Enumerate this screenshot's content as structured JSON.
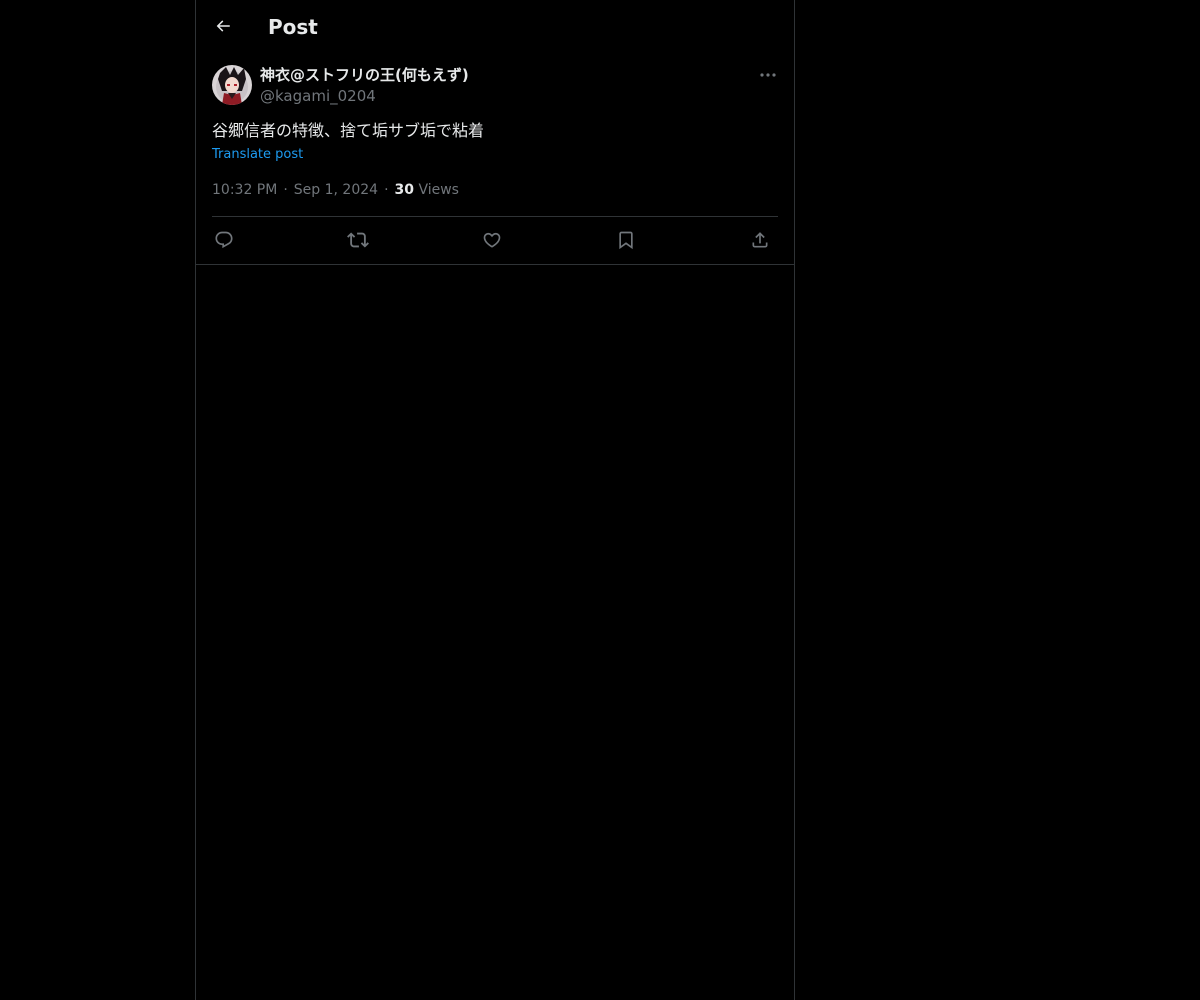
{
  "header": {
    "title": "Post",
    "back_icon": "arrow-left-icon"
  },
  "post": {
    "author": {
      "display_name": "神衣@ストフリの王(何もえず)",
      "handle": "@kagami_0204",
      "avatar_icon": "avatar"
    },
    "more_icon": "more-dots-icon",
    "text": "谷郷信者の特徴、捨て垢サブ垢で粘着",
    "translate_label": "Translate post",
    "time": "10:32 PM",
    "separator": "·",
    "date": "Sep 1, 2024",
    "views_count": "30",
    "views_label": "Views"
  },
  "actions": [
    {
      "name": "reply",
      "icon": "reply-icon"
    },
    {
      "name": "repost",
      "icon": "repost-icon"
    },
    {
      "name": "like",
      "icon": "heart-icon"
    },
    {
      "name": "bookmark",
      "icon": "bookmark-icon"
    },
    {
      "name": "share",
      "icon": "share-icon"
    }
  ],
  "colors": {
    "background": "#000000",
    "text_primary": "#e7e9ea",
    "text_secondary": "#71767b",
    "accent": "#1d9bf0",
    "border": "#2f3336"
  }
}
